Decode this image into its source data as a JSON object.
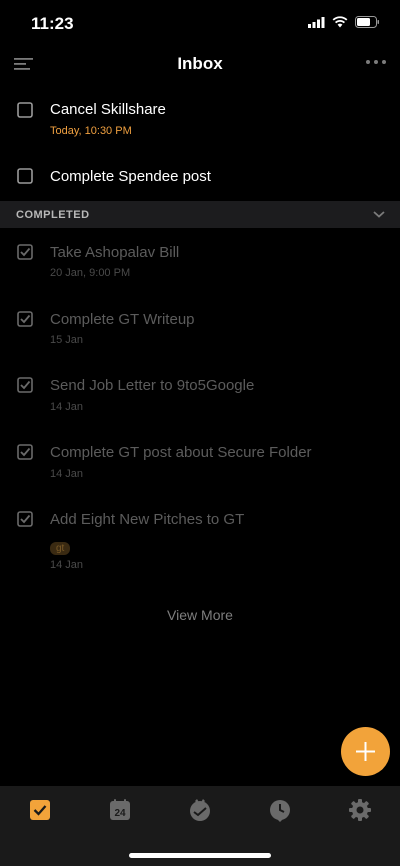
{
  "status_bar": {
    "time": "11:23"
  },
  "header": {
    "title": "Inbox"
  },
  "pending_tasks": [
    {
      "title": "Cancel Skillshare",
      "due": "Today, 10:30 PM"
    },
    {
      "title": "Complete Spendee post"
    }
  ],
  "completed_section": {
    "label": "COMPLETED"
  },
  "completed_tasks": [
    {
      "title": "Take Ashopalav Bill",
      "due": "20 Jan, 9:00 PM"
    },
    {
      "title": "Complete GT Writeup",
      "due": "15 Jan"
    },
    {
      "title": "Send Job Letter to 9to5Google",
      "due": "14 Jan"
    },
    {
      "title": "Complete GT post about Secure Folder",
      "due": "14 Jan"
    },
    {
      "title": "Add Eight New Pitches to GT",
      "tag": "gt",
      "due": "14 Jan"
    }
  ],
  "view_more": "View More",
  "tabbar": {
    "calendar_day": "24",
    "tabs": [
      "tasks-icon",
      "calendar-icon",
      "habit-icon",
      "pomodoro-clock-icon",
      "settings-gear-icon"
    ]
  },
  "colors": {
    "accent": "#f2a33a",
    "due_today": "#f0a040",
    "background": "#000000",
    "section_bg": "#1c1c1e",
    "tabbar_bg": "#1a1a1a"
  }
}
